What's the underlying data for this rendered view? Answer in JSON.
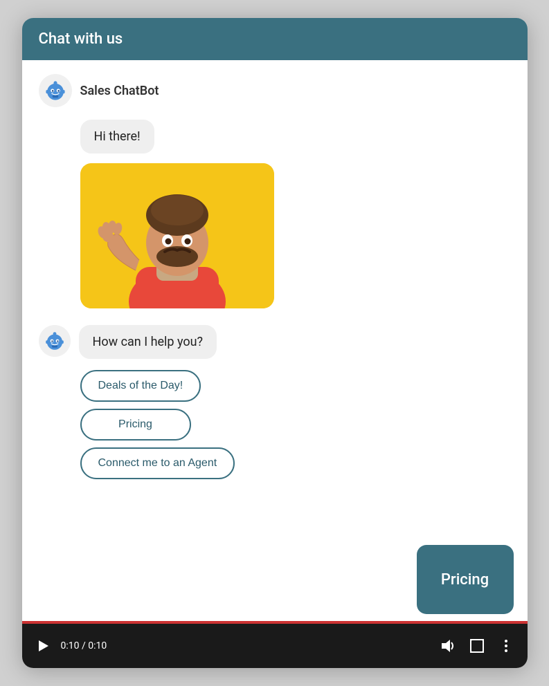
{
  "header": {
    "title": "Chat with us",
    "background_color": "#3a7080"
  },
  "bot": {
    "name": "Sales ChatBot"
  },
  "messages": [
    {
      "id": "msg1",
      "type": "text",
      "text": "Hi there!"
    },
    {
      "id": "msg2",
      "type": "image",
      "alt": "Sales chatbot character waving"
    },
    {
      "id": "msg3",
      "type": "text",
      "text": "How can I help you?",
      "show_avatar": true
    }
  ],
  "quick_replies": [
    {
      "id": "qr1",
      "label": "Deals of the Day!"
    },
    {
      "id": "qr2",
      "label": "Pricing"
    },
    {
      "id": "qr3",
      "label": "Connect me to an Agent"
    }
  ],
  "pricing_overlay": {
    "label": "Pricing"
  },
  "video_controls": {
    "play_icon": "▶",
    "time": "0:10 / 0:10",
    "volume_icon": "🔊",
    "fullscreen_icon": "⛶",
    "more_icon": "⋮"
  }
}
